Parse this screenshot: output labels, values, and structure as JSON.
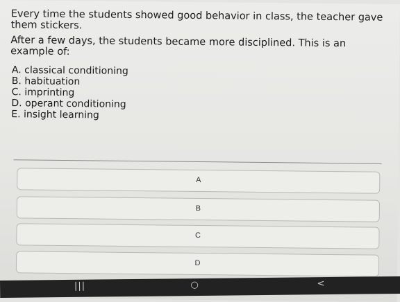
{
  "question": {
    "line1": "Every time the students showed good behavior in class, the teacher gave them stickers.",
    "line2": "After a few days, the students became more disciplined. This is an example of:"
  },
  "choices": [
    "A. classical conditioning",
    "B. habituation",
    "C. imprinting",
    "D. operant conditioning",
    "E. insight learning"
  ],
  "answers": [
    "A",
    "B",
    "C",
    "D"
  ],
  "navbar": {
    "recent": "|||",
    "home": "○",
    "back": "<"
  }
}
